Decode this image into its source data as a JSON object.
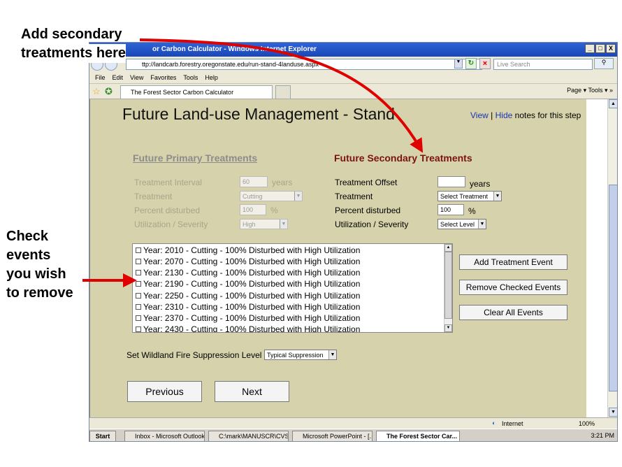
{
  "annotations": {
    "top_line1": "Add secondary",
    "top_line2": "treatments here",
    "left_line1": "Check",
    "left_line2": "events",
    "left_line3": "you wish",
    "left_line4": "to remove"
  },
  "browser": {
    "window_title": "or Carbon Calculator - Windows Internet Explorer",
    "window_buttons": [
      "_",
      "̸",
      "X"
    ],
    "address": "ttp://landcarb.forestry.oregonstate.edu/run-stand-4landuse.aspx",
    "search_placeholder": "Live Search",
    "menu": [
      "File",
      "Edit",
      "View",
      "Favorites",
      "Tools",
      "Help"
    ],
    "tab_title": "The Forest Sector Carbon Calculator",
    "command_bar": "Page ▾  Tools ▾  »",
    "status_zone": "Internet",
    "zoom": "100%"
  },
  "page": {
    "title": "Future Land-use Management - Stand",
    "notes_view": "View",
    "notes_sep": "|",
    "notes_hide": "Hide",
    "notes_suffix": "notes for this step",
    "primary_header": "Future Primary Treatments",
    "secondary_header": "Future Secondary Treatments",
    "primary": {
      "interval_label": "Treatment Interval",
      "interval_value": "60",
      "interval_unit": "years",
      "treatment_label": "Treatment",
      "treatment_value": "Cutting",
      "percent_label": "Percent disturbed",
      "percent_value": "100",
      "percent_unit": "%",
      "util_label": "Utilization / Severity",
      "util_value": "High"
    },
    "secondary": {
      "offset_label": "Treatment Offset",
      "offset_value": "",
      "offset_unit": "years",
      "treatment_label": "Treatment",
      "treatment_value": "Select Treatment",
      "percent_label": "Percent disturbed",
      "percent_value": "100",
      "percent_unit": "%",
      "util_label": "Utilization / Severity",
      "util_value": "Select Level"
    },
    "events": [
      "Year: 2010 - Cutting - 100% Disturbed with High Utilization",
      "Year: 2070 - Cutting - 100% Disturbed with High Utilization",
      "Year: 2130 - Cutting - 100% Disturbed with High Utilization",
      "Year: 2190 - Cutting - 100% Disturbed with High Utilization",
      "Year: 2250 - Cutting - 100% Disturbed with High Utilization",
      "Year: 2310 - Cutting - 100% Disturbed with High Utilization",
      "Year: 2370 - Cutting - 100% Disturbed with High Utilization",
      "Year: 2430 - Cutting - 100% Disturbed with High Utilization"
    ],
    "buttons": {
      "add": "Add Treatment Event",
      "remove": "Remove Checked Events",
      "clear": "Clear All Events",
      "previous": "Previous",
      "next": "Next"
    },
    "fire_label": "Set Wildland Fire Suppression Level",
    "fire_value": "Typical Suppression"
  },
  "taskbar": {
    "start": "Start",
    "items": [
      "Inbox - Microsoft Outlook",
      "C:\\mark\\MANUSCR\\CVS",
      "Microsoft PowerPoint - [...",
      "The Forest Sector Car..."
    ],
    "clock": "3:21 PM"
  },
  "colors": {
    "content_bg": "#d6d2ab",
    "secondary_header": "#7a1212",
    "arrow": "#e00000",
    "link": "#1a33b8"
  }
}
